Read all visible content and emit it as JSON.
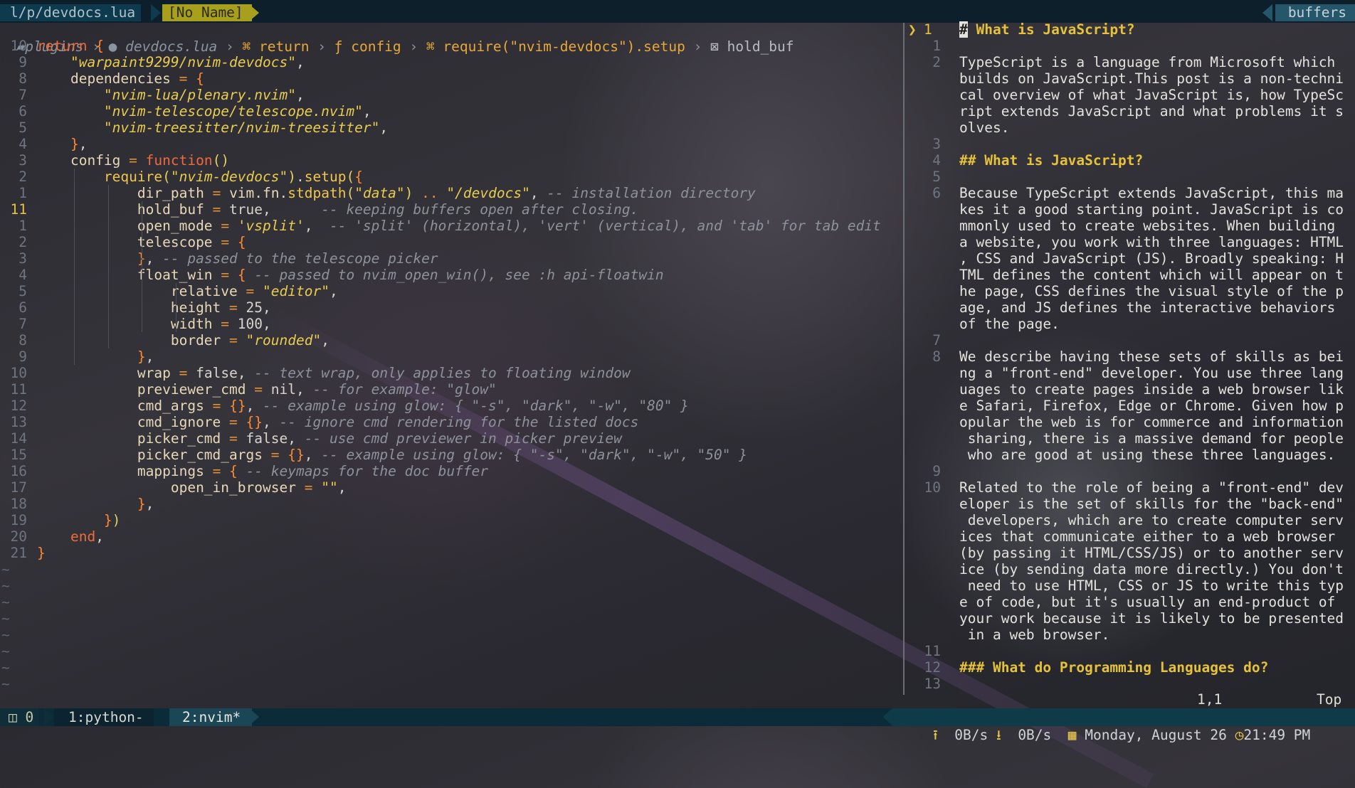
{
  "tabline": {
    "file": "l/p/devdocs.lua",
    "noname": "[No Name]",
    "buffers": "buffers"
  },
  "winbar": {
    "folder": "plugins",
    "file": "devdocs.lua",
    "crumbs": [
      "return",
      "config",
      "require(\"nvim-devdocs\").setup",
      "hold_buf"
    ]
  },
  "editor": {
    "line_numbers": [
      "10",
      "9",
      "8",
      "7",
      "6",
      "5",
      "4",
      "3",
      "2",
      "1",
      "11",
      "1",
      "2",
      "3",
      "4",
      "5",
      "6",
      "7",
      "8",
      "9",
      "10",
      "11",
      "12",
      "13",
      "14",
      "15",
      "16",
      "17",
      "18",
      "19",
      "20",
      "21"
    ],
    "current_line_index": 10,
    "lines": [
      "return {",
      "    \"warpaint9299/nvim-devdocs\",",
      "    dependencies = {",
      "        \"nvim-lua/plenary.nvim\",",
      "        \"nvim-telescope/telescope.nvim\",",
      "        \"nvim-treesitter/nvim-treesitter\",",
      "    },",
      "    config = function()",
      "        require(\"nvim-devdocs\").setup({",
      "            dir_path = vim.fn.stdpath(\"data\") .. \"/devdocs\", -- installation directory",
      "            hold_buf = true,      -- keeping buffers open after closing.",
      "            open_mode = 'vsplit',  -- 'split' (horizontal), 'vert' (vertical), and 'tab' for tab edit",
      "            telescope = {",
      "            }, -- passed to the telescope picker",
      "            float_win = { -- passed to nvim_open_win(), see :h api-floatwin",
      "                relative = \"editor\",",
      "                height = 25,",
      "                width = 100,",
      "                border = \"rounded\",",
      "            },",
      "            wrap = false, -- text wrap, only applies to floating window",
      "            previewer_cmd = nil, -- for example: \"glow\"",
      "            cmd_args = {}, -- example using glow: { \"-s\", \"dark\", \"-w\", \"80\" }",
      "            cmd_ignore = {}, -- ignore cmd rendering for the listed docs",
      "            picker_cmd = false, -- use cmd previewer in picker preview",
      "            picker_cmd_args = {}, -- example using glow: { \"-s\", \"dark\", \"-w\", \"50\" }",
      "            mappings = { -- keymaps for the doc buffer",
      "                open_in_browser = \"\",",
      "            },",
      "        })",
      "    end,",
      "}"
    ],
    "tilde": "~"
  },
  "doc": {
    "cursor_marker": "❯",
    "cursor_linenr": "1",
    "rows": [
      {
        "n": "",
        "t": "# What is JavaScript?",
        "h": true
      },
      {
        "n": "1",
        "t": ""
      },
      {
        "n": "2",
        "t": "TypeScript is a language from Microsoft which"
      },
      {
        "n": "",
        "t": "builds on JavaScript.This post is a non-techni"
      },
      {
        "n": "",
        "t": "cal overview of what JavaScript is, how TypeSc"
      },
      {
        "n": "",
        "t": "ript extends JavaScript and what problems it s"
      },
      {
        "n": "",
        "t": "olves."
      },
      {
        "n": "3",
        "t": ""
      },
      {
        "n": "4",
        "t": "## What is JavaScript?",
        "h": true
      },
      {
        "n": "5",
        "t": ""
      },
      {
        "n": "6",
        "t": "Because TypeScript extends JavaScript, this ma"
      },
      {
        "n": "",
        "t": "kes it a good starting point. JavaScript is co"
      },
      {
        "n": "",
        "t": "mmonly used to create websites. When building"
      },
      {
        "n": "",
        "t": "a website, you work with three languages: HTML"
      },
      {
        "n": "",
        "t": ", CSS and JavaScript (JS). Broadly speaking: H"
      },
      {
        "n": "",
        "t": "TML defines the content which will appear on t"
      },
      {
        "n": "",
        "t": "he page, CSS defines the visual style of the p"
      },
      {
        "n": "",
        "t": "age, and JS defines the interactive behaviors"
      },
      {
        "n": "",
        "t": "of the page."
      },
      {
        "n": "7",
        "t": ""
      },
      {
        "n": "8",
        "t": "We describe having these sets of skills as bei"
      },
      {
        "n": "",
        "t": "ng a \"front-end\" developer. You use three lang"
      },
      {
        "n": "",
        "t": "uages to create pages inside a web browser lik"
      },
      {
        "n": "",
        "t": "e Safari, Firefox, Edge or Chrome. Given how p"
      },
      {
        "n": "",
        "t": "opular the web is for commerce and information"
      },
      {
        "n": "",
        "t": " sharing, there is a massive demand for people"
      },
      {
        "n": "",
        "t": " who are good at using these three languages."
      },
      {
        "n": "9",
        "t": ""
      },
      {
        "n": "10",
        "t": "Related to the role of being a \"front-end\" dev"
      },
      {
        "n": "",
        "t": "eloper is the set of skills for the \"back-end\""
      },
      {
        "n": "",
        "t": " developers, which are to create computer serv"
      },
      {
        "n": "",
        "t": "ices that communicate either to a web browser"
      },
      {
        "n": "",
        "t": "(by passing it HTML/CSS/JS) or to another serv"
      },
      {
        "n": "",
        "t": "ice (by sending data more directly.) You don't"
      },
      {
        "n": "",
        "t": " need to use HTML, CSS or JS to write this typ"
      },
      {
        "n": "",
        "t": "e of code, but it's usually an end-product of"
      },
      {
        "n": "",
        "t": "your work because it is likely to be presented"
      },
      {
        "n": "",
        "t": " in a web browser."
      },
      {
        "n": "11",
        "t": ""
      },
      {
        "n": "12",
        "t": "### What do Programming Languages do?",
        "h": true
      },
      {
        "n": "13",
        "t": ""
      }
    ],
    "ruler_pos": "1,1",
    "ruler_pct": "Top"
  },
  "status": {
    "session": "0",
    "win1": "1:python-",
    "win2": "2:nvim*",
    "upload": "0B/s",
    "download": "0B/s",
    "date": "Monday, August 26",
    "time": "21:49 PM"
  }
}
